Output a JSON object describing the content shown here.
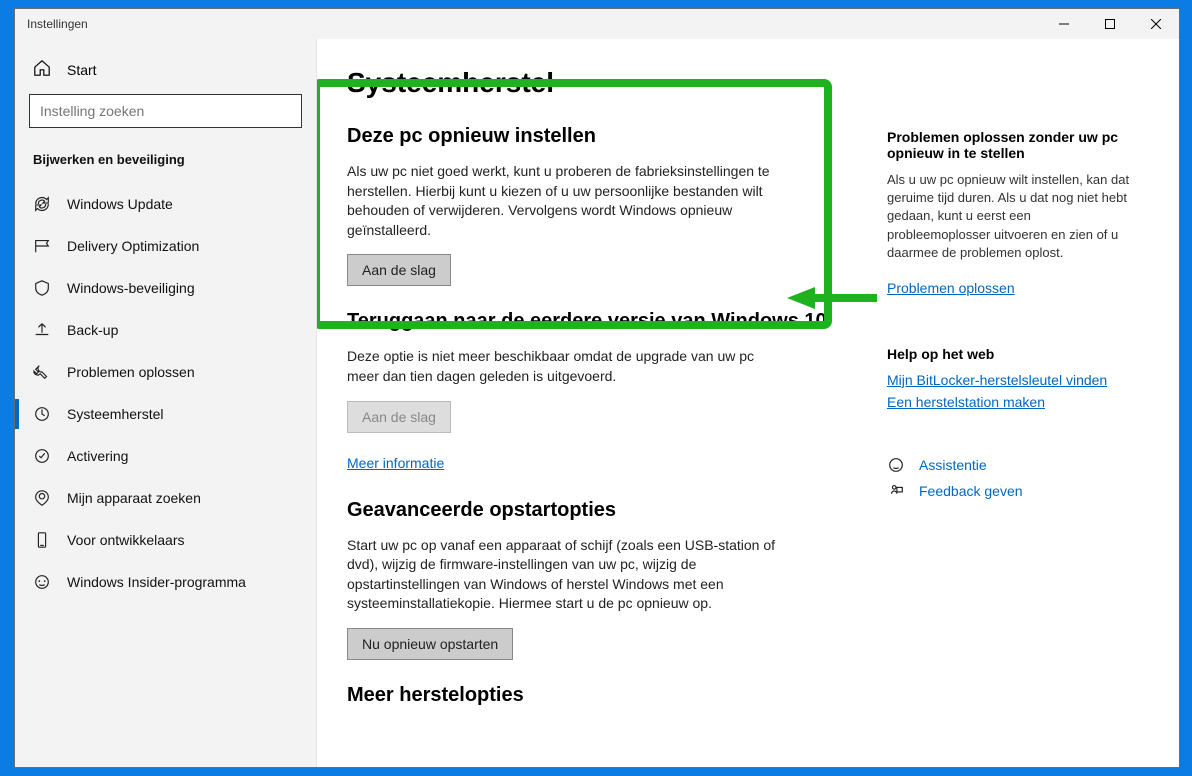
{
  "title": "Instellingen",
  "sidebar": {
    "home": "Start",
    "search_placeholder": "Instelling zoeken",
    "group_title": "Bijwerken en beveiliging",
    "items": [
      {
        "label": "Windows Update",
        "icon": "sync"
      },
      {
        "label": "Delivery Optimization",
        "icon": "delivery"
      },
      {
        "label": "Windows-beveiliging",
        "icon": "shield"
      },
      {
        "label": "Back-up",
        "icon": "backup"
      },
      {
        "label": "Problemen oplossen",
        "icon": "troubleshoot"
      },
      {
        "label": "Systeemherstel",
        "icon": "recovery",
        "active": true
      },
      {
        "label": "Activering",
        "icon": "activation"
      },
      {
        "label": "Mijn apparaat zoeken",
        "icon": "find"
      },
      {
        "label": "Voor ontwikkelaars",
        "icon": "dev"
      },
      {
        "label": "Windows Insider-programma",
        "icon": "insider"
      }
    ]
  },
  "content": {
    "page_title": "Systeemherstel",
    "reset": {
      "heading": "Deze pc opnieuw instellen",
      "text": "Als uw pc niet goed werkt, kunt u proberen de fabrieksinstellingen te herstellen. Hierbij kunt u kiezen of u uw persoonlijke bestanden wilt behouden of verwijderen. Vervolgens wordt Windows opnieuw geïnstalleerd.",
      "button": "Aan de slag"
    },
    "goback": {
      "heading": "Teruggaan naar de eerdere versie van Windows 10",
      "text": "Deze optie is niet meer beschikbaar omdat de upgrade van uw pc meer dan tien dagen geleden is uitgevoerd.",
      "button": "Aan de slag",
      "more_info": "Meer informatie"
    },
    "advanced": {
      "heading": "Geavanceerde opstartopties",
      "text": "Start uw pc op vanaf een apparaat of schijf (zoals een USB-station of dvd), wijzig de firmware-instellingen van uw pc, wijzig de opstartinstellingen van Windows of herstel Windows met een systeeminstallatiekopie. Hiermee start u de pc opnieuw op.",
      "button": "Nu opnieuw opstarten"
    },
    "more_options_heading": "Meer herstelopties"
  },
  "rightcol": {
    "tip_heading": "Problemen oplossen zonder uw pc opnieuw in te stellen",
    "tip_text": "Als u uw pc opnieuw wilt instellen, kan dat geruime tijd duren. Als u dat nog niet hebt gedaan, kunt u eerst een probleemoplosser uitvoeren en zien of u daarmee de problemen oplost.",
    "tip_link": "Problemen oplossen",
    "help_heading": "Help op het web",
    "help_links": [
      "Mijn BitLocker-herstelsleutel vinden",
      "Een herstelstation maken"
    ],
    "support_links": [
      {
        "label": "Assistentie",
        "icon": "assist"
      },
      {
        "label": "Feedback geven",
        "icon": "feedback"
      }
    ]
  }
}
